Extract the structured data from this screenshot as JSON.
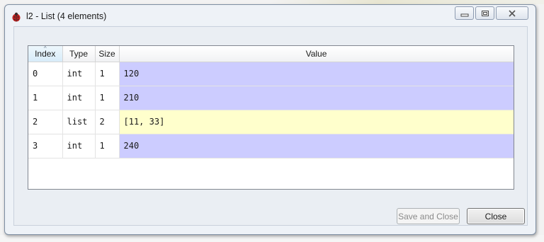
{
  "window": {
    "title": "l2 - List (4 elements)",
    "controls": {
      "minimize": "minimize",
      "maximize": "maximize",
      "close": "close"
    }
  },
  "table": {
    "columns": [
      "Index",
      "Type",
      "Size",
      "Value"
    ],
    "sorted_column": "Index",
    "rows": [
      {
        "index": "0",
        "type": "int",
        "size": "1",
        "value": "120"
      },
      {
        "index": "1",
        "type": "int",
        "size": "1",
        "value": "210"
      },
      {
        "index": "2",
        "type": "list",
        "size": "2",
        "value": "[11, 33]"
      },
      {
        "index": "3",
        "type": "int",
        "size": "1",
        "value": "240"
      }
    ]
  },
  "buttons": {
    "save_and_close": "Save and Close",
    "close": "Close"
  },
  "colors": {
    "int_value_bg": "#ccccff",
    "list_value_bg": "#ffffcc"
  },
  "icons": {
    "app": "ladybug-icon",
    "sort": "sort-ascending-icon"
  }
}
